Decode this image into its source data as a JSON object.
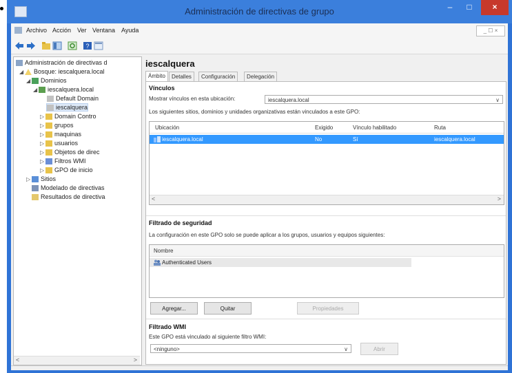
{
  "window": {
    "title": "Administración de directivas de grupo",
    "minimize": "–",
    "maximize": "□",
    "close": "×",
    "mdi_controls": "_ ☐ ×"
  },
  "menu": {
    "items": [
      "Archivo",
      "Acción",
      "Ver",
      "Ventana",
      "Ayuda"
    ]
  },
  "tree": {
    "root": "Administración de directivas d",
    "forest": "Bosque: iescalquera.local",
    "domains": "Dominios",
    "domain": "iescalquera.local",
    "items": [
      "Default Domain",
      "iescalquera",
      "Domain Contro",
      "grupos",
      "maquinas",
      "usuarios",
      "Objetos de direc",
      "Filtros WMI",
      "GPO de inicio"
    ],
    "sites": "Sitios",
    "modeling": "Modelado de directivas",
    "results": "Resultados de directiva"
  },
  "gpo": {
    "title": "iescalquera",
    "tabs": [
      "Ámbito",
      "Detalles",
      "Configuración",
      "Delegación"
    ],
    "links": {
      "heading": "Vínculos",
      "show_label": "Mostrar vínculos en esta ubicación:",
      "location_value": "iescalquera.local",
      "desc": "Los siguientes sitios, dominios y unidades organizativas están vinculados a este GPO:",
      "columns": [
        "Ubicación",
        "Exigido",
        "Vínculo habilitado",
        "Ruta"
      ],
      "rows": [
        {
          "location": "iescalquera.local",
          "enforced": "No",
          "enabled": "Sí",
          "path": "iescalquera.local"
        }
      ]
    },
    "security": {
      "heading": "Filtrado de seguridad",
      "desc": "La configuración en este GPO solo se puede aplicar a los grupos, usuarios y equipos siguientes:",
      "column": "Nombre",
      "rows": [
        "Authenticated Users"
      ],
      "buttons": {
        "add": "Agregar...",
        "remove": "Quitar",
        "properties": "Propiedades"
      }
    },
    "wmi": {
      "heading": "Filtrado WMI",
      "desc": "Este GPO está vinculado al siguiente filtro WMI:",
      "value": "<ninguno>",
      "open": "Abrir"
    }
  },
  "colors": {
    "titlebar": "#3b7fdc",
    "selection": "#3399ff",
    "close": "#c7392b"
  }
}
